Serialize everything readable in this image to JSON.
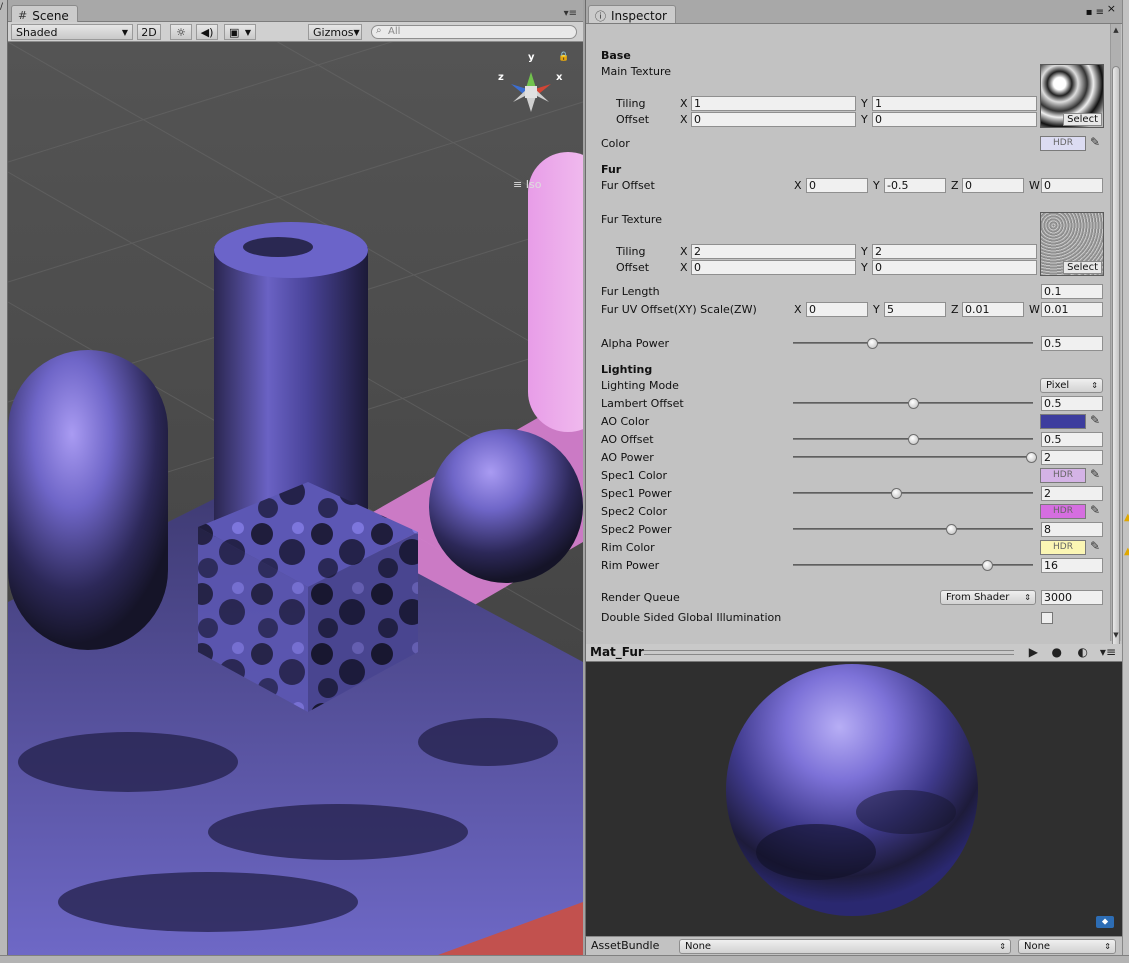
{
  "scene": {
    "tab_label": "Scene",
    "shading_mode": "Shaded",
    "mode_2d": "2D",
    "gizmos_label": "Gizmos",
    "search_placeholder": "All",
    "gizmo_axes": {
      "x": "x",
      "y": "y",
      "z": "z"
    },
    "projection_label": "Iso"
  },
  "inspector": {
    "tab_label": "Inspector",
    "sections": {
      "base": "Base",
      "fur": "Fur",
      "lighting": "Lighting"
    },
    "main_texture": {
      "label": "Main Texture",
      "tiling_label": "Tiling",
      "offset_label": "Offset",
      "tiling": {
        "x": "1",
        "y": "1"
      },
      "offset": {
        "x": "0",
        "y": "0"
      },
      "select_label": "Select"
    },
    "color": {
      "label": "Color",
      "swatch_text": "HDR"
    },
    "fur_offset": {
      "label": "Fur Offset",
      "x": "0",
      "y": "-0.5",
      "z": "0",
      "w": "0"
    },
    "fur_texture": {
      "label": "Fur Texture",
      "tiling_label": "Tiling",
      "offset_label": "Offset",
      "tiling": {
        "x": "2",
        "y": "2"
      },
      "offset": {
        "x": "0",
        "y": "0"
      },
      "select_label": "Select"
    },
    "fur_length": {
      "label": "Fur Length",
      "value": "0.1"
    },
    "fur_uv": {
      "label": "Fur UV Offset(XY) Scale(ZW)",
      "x": "0",
      "y": "5",
      "z": "0.01",
      "w": "0.01"
    },
    "alpha_power": {
      "label": "Alpha Power",
      "value": "0.5",
      "fraction": 0.33
    },
    "lighting_mode": {
      "label": "Lighting Mode",
      "value": "Pixel"
    },
    "lambert_offset": {
      "label": "Lambert Offset",
      "value": "0.5",
      "fraction": 0.5
    },
    "ao_color": {
      "label": "AO Color",
      "color": "#3d3d9e"
    },
    "ao_offset": {
      "label": "AO Offset",
      "value": "0.5",
      "fraction": 0.5
    },
    "ao_power": {
      "label": "AO Power",
      "value": "2",
      "fraction": 0.99
    },
    "spec1_color": {
      "label": "Spec1 Color",
      "swatch_text": "HDR",
      "color": "#d4b3e6"
    },
    "spec1_power": {
      "label": "Spec1 Power",
      "value": "2",
      "fraction": 0.43
    },
    "spec2_color": {
      "label": "Spec2 Color",
      "swatch_text": "HDR",
      "color": "#d56ee0"
    },
    "spec2_power": {
      "label": "Spec2 Power",
      "value": "8",
      "fraction": 0.66
    },
    "rim_color": {
      "label": "Rim Color",
      "swatch_text": "HDR",
      "color": "#fbf6b4"
    },
    "rim_power": {
      "label": "Rim Power",
      "value": "16",
      "fraction": 0.81
    },
    "render_queue": {
      "label": "Render Queue",
      "mode": "From Shader",
      "value": "3000"
    },
    "double_sided_gi": {
      "label": "Double Sided Global Illumination",
      "checked": false
    },
    "axis": {
      "x": "X",
      "y": "Y",
      "z": "Z",
      "w": "W"
    }
  },
  "preview": {
    "title": "Mat_Fur"
  },
  "asset_bundle": {
    "label": "AssetBundle",
    "name": "None",
    "variant": "None"
  }
}
